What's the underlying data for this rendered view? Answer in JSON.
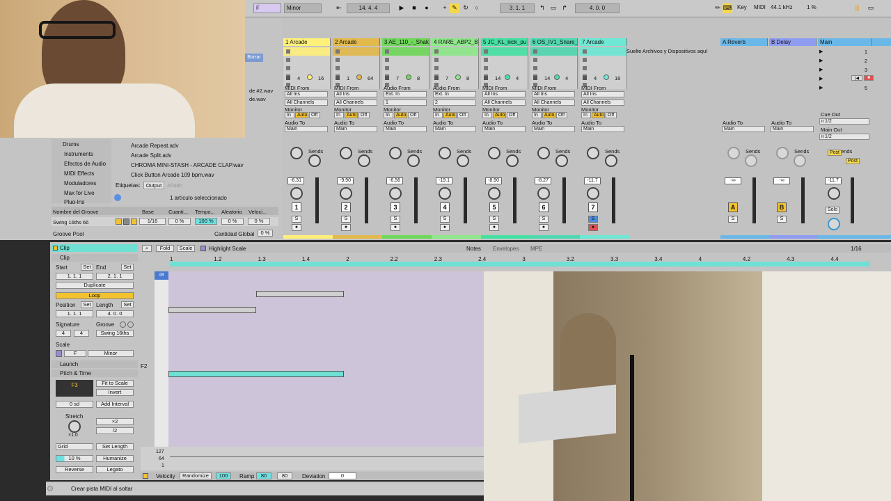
{
  "toolbar": {
    "key_label": "F",
    "scale_label": "Minor",
    "tempo_position": "14.   4.   4",
    "arrangement_pos": "3.   1.   1",
    "loop_len": "4.   0.   0",
    "key_button": "Key",
    "midi_button": "MIDI",
    "sample_rate": "44.1 kHz",
    "cpu": "1 %"
  },
  "browser": {
    "places": [
      "Drums",
      "Instruments",
      "Efectos de Audio",
      "MIDI Effects",
      "Moduladores",
      "Max for Live",
      "Plug-Ins"
    ],
    "files": [
      "Arcade Repeat.adv",
      "Arcade Split.adv",
      "CHROMA MINI-STASH - ARCADE CLAP.wav",
      "Click Button Arcade 109 bpm.wav"
    ],
    "partial_files": [
      "de #2.wav",
      "de.wav"
    ],
    "borrar": "Borrar",
    "tags_label": "Etiquetas:",
    "output_label": "Output",
    "add_label": "Añadir",
    "selected": "1 artículo seleccionado"
  },
  "groove": {
    "col_name": "Nombre del Groove",
    "col_base": "Base",
    "col_quant": "Cuanti...",
    "col_tempo": "Tempo...",
    "col_random": "Aleatorio",
    "col_vel": "Veloci...",
    "row_name": "Swing 16ths 66",
    "row_base": "1/16",
    "row_quant": "0 %",
    "row_tempo": "100 %",
    "row_random": "0 %",
    "row_vel": "0 %",
    "pool": "Groove Pool",
    "global_label": "Cantidad Global",
    "global_value": "0 %"
  },
  "drop_hint": "Suelte Archivos y Dispositivos aquí",
  "tracks": [
    {
      "name": "1 Arcade",
      "color": "#fff07a",
      "input": "MIDI From",
      "src": "All Ins",
      "chan": "All Channels",
      "vol": "-6.31",
      "num": "1",
      "clip": "4",
      "clip2": "16"
    },
    {
      "name": "2 Arcade",
      "color": "#e2b94b",
      "input": "MIDI From",
      "src": "All Ins",
      "chan": "All Channels",
      "vol": "-9.90",
      "num": "2",
      "clip": "1",
      "clip2": "64"
    },
    {
      "name": "3 AE_110_-_Shak",
      "color": "#6fd85a",
      "input": "Audio From",
      "src": "Ext. In",
      "chan": "1",
      "vol": "-6.56",
      "num": "3",
      "clip": "7",
      "clip2": "8"
    },
    {
      "name": "4 RARE_ABP2_Bir",
      "color": "#8ee88a",
      "input": "Audio From",
      "src": "Ext. In",
      "chan": "2",
      "vol": "-19.1",
      "num": "4",
      "clip": "7",
      "clip2": "8"
    },
    {
      "name": "5 JC_KL_kick_pu",
      "color": "#44e0a4",
      "input": "MIDI From",
      "src": "All Ins",
      "chan": "All Channels",
      "vol": "-8.90",
      "num": "5",
      "clip": "14",
      "clip2": "4"
    },
    {
      "name": "6 OS_IV1_Snare_",
      "color": "#4fd8b0",
      "input": "MIDI From",
      "src": "All Ins",
      "chan": "All Channels",
      "vol": "-8.27",
      "num": "6",
      "clip": "14",
      "clip2": "4"
    },
    {
      "name": "7 Arcade",
      "color": "#6ee8d4",
      "input": "MIDI From",
      "src": "All Ins",
      "chan": "All Channels",
      "vol": "-11.7",
      "num": "7",
      "clip": "4",
      "clip2": "16"
    }
  ],
  "returns": [
    {
      "name": "A Reverb",
      "letter": "A",
      "color": "#6ab8e8"
    },
    {
      "name": "B Delay",
      "letter": "B",
      "color": "#8f9cf0"
    }
  ],
  "master": {
    "name": "Main",
    "scenes": [
      "1",
      "2",
      "3",
      "4",
      "5"
    ],
    "cue_out": "Cue Out",
    "cue_val": "ii 1/2",
    "main_out": "Main Out",
    "main_val": "ii 1/2",
    "vol": "-11.7",
    "solo": "Solo",
    "post": "Post"
  },
  "mixer_labels": {
    "monitor": "Monitor",
    "in": "In",
    "auto": "Auto",
    "off": "Off",
    "audio_to": "Audio To",
    "main": "Main",
    "sends": "Sends",
    "inf": "-∞",
    "s": "S"
  },
  "clip": {
    "title": "Clip",
    "section": "Clip",
    "start": "Start",
    "end": "End",
    "set": "Set",
    "start_val": "1.   1.   1",
    "end_val": "2.   1.   1",
    "duplicate": "Duplicate",
    "loop": "Loop",
    "position": "Position",
    "length": "Length",
    "pos_val": "1.   1.   1",
    "len_val": "4.   0.   0",
    "signature": "Signature",
    "groove": "Groove",
    "sig_num": "4",
    "sig_den": "4",
    "groove_val": "Swing 16ths",
    "scale": "Scale",
    "scale_root": "F",
    "scale_name": "Minor",
    "launch": "Launch",
    "pitch_time": "Pitch & Time",
    "note_box": "F3",
    "fit_scale": "Fit to Scale",
    "invert": "Invert",
    "semitones": "0 sd",
    "add_interval": "Add Interval",
    "stretch": "Stretch",
    "x2": "×2",
    "div2": "/2",
    "stretch_val": "×1.0",
    "grid": "Grid",
    "set_length": "Set Length",
    "humanize_val": "10 %",
    "humanize": "Humanize",
    "reverse": "Reverse",
    "legato": "Legato"
  },
  "roll": {
    "fold": "Fold",
    "scale": "Scale",
    "highlight": "Highlight Scale",
    "notes_tab": "Notes",
    "envelopes_tab": "Envelopes",
    "mpe_tab": "MPE",
    "grid_val": "1/16",
    "ruler": [
      "1",
      "1.2",
      "1.3",
      "1.4",
      "2",
      "2.2",
      "2.3",
      "2.4",
      "3",
      "3.2",
      "3.3",
      "3.4",
      "4",
      "4.2",
      "4.3",
      "4.4"
    ],
    "f2_label": "F2",
    "vel_top": "127",
    "vel_mid": "64",
    "vel_bot": "1",
    "velocity": "Velocity",
    "randomize": "Randomize",
    "rand_val": "100",
    "ramp": "Ramp",
    "ramp_a": "80",
    "ramp_b": "80",
    "deviation": "Deviation",
    "dev_val": "0"
  },
  "status": "Crear pista MIDI al soltar"
}
